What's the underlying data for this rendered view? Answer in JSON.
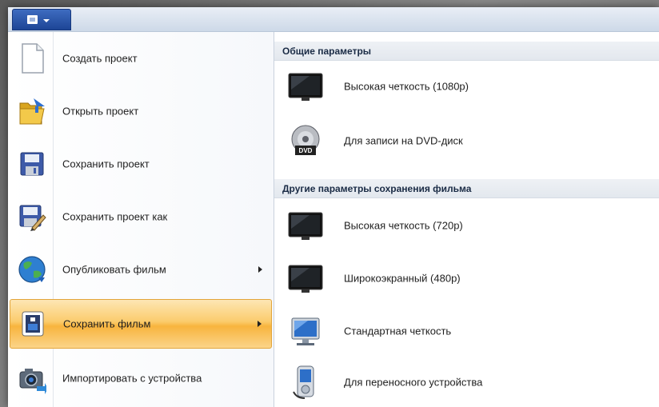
{
  "window": {
    "app_menu_button": {
      "icon": "app-menu-icon"
    }
  },
  "left_menu": {
    "items": [
      {
        "label": "Создать проект",
        "icon": "new-document-icon",
        "has_submenu": false
      },
      {
        "label": "Открыть проект",
        "icon": "open-folder-icon",
        "has_submenu": false
      },
      {
        "label": "Сохранить проект",
        "icon": "save-disk-icon",
        "has_submenu": false
      },
      {
        "label": "Сохранить проект как",
        "icon": "save-as-icon",
        "has_submenu": false
      },
      {
        "label": "Опубликовать фильм",
        "icon": "globe-publish-icon",
        "has_submenu": true
      },
      {
        "label": "Сохранить фильм",
        "icon": "save-movie-icon",
        "has_submenu": true,
        "selected": true
      },
      {
        "label": "Импортировать с устройства",
        "icon": "camera-import-icon",
        "has_submenu": false
      }
    ]
  },
  "right_panel": {
    "sections": [
      {
        "header": "Общие параметры",
        "items": [
          {
            "label": "Высокая четкость (1080p)",
            "icon": "hd-tv-icon"
          },
          {
            "label": "Для записи на DVD-диск",
            "icon": "dvd-disc-icon"
          }
        ]
      },
      {
        "header": "Другие параметры сохранения фильма",
        "items": [
          {
            "label": "Высокая четкость (720p)",
            "icon": "hd-tv-icon"
          },
          {
            "label": "Широкоэкранный (480p)",
            "icon": "widescreen-tv-icon"
          },
          {
            "label": "Стандартная четкость",
            "icon": "standard-monitor-icon"
          },
          {
            "label": "Для переносного устройства",
            "icon": "portable-device-icon"
          }
        ]
      }
    ]
  },
  "colors": {
    "selected_gradient_top": "#fde6b4",
    "selected_gradient_mid": "#f8b43e",
    "selected_border": "#e3a53a",
    "app_button": "#2a55a8"
  }
}
